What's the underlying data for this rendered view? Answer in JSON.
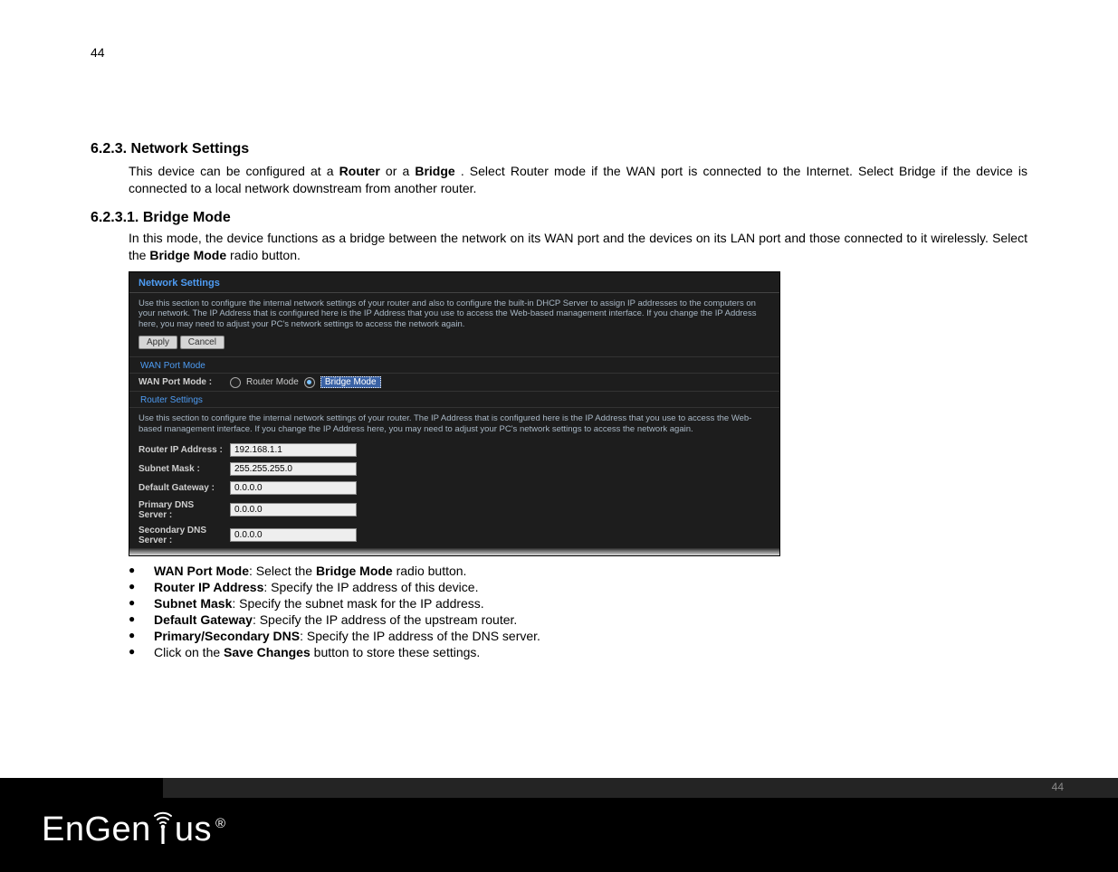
{
  "page_number_top": "44",
  "page_number_bottom": "44",
  "brand": {
    "left": "EnGen",
    "right": "us",
    "trademark": "®"
  },
  "section": {
    "num_title": "6.2.3. Network Settings",
    "intro_a": "This device can be configured at a ",
    "intro_router": "Router",
    "intro_b": " or a ",
    "intro_bridge": "Bridge",
    "intro_c": ". Select Router mode if the WAN port is connected to the Internet. Select Bridge if the device is connected to a local network downstream from another router."
  },
  "subsection": {
    "num_title": "6.2.3.1. Bridge Mode",
    "intro_a": "In this mode, the device functions as a bridge between the network on its WAN port and the devices on its LAN port and those connected to it wirelessly. Select the ",
    "bold": "Bridge Mode",
    "intro_b": " radio button."
  },
  "panel": {
    "title": "Network Settings",
    "note1": "Use this section to configure the internal network settings of your router and also to configure the built-in DHCP Server to assign IP addresses to the computers on your network. The IP Address that is configured here is the IP Address that you use to access the Web-based management interface. If you change the IP Address here, you may need to adjust your PC's network settings to access the network again.",
    "apply": "Apply",
    "cancel": "Cancel",
    "sub_wanmode": "WAN Port Mode",
    "wanlabel": "WAN Port Mode :",
    "opt_router": "Router Mode",
    "opt_bridge": "Bridge Mode",
    "sub_router": "Router Settings",
    "note2": "Use this section to configure the internal network settings of your router. The IP Address that is configured here is the IP Address that you use to access the Web-based management interface. If you change the IP Address here, you may need to adjust your PC's network settings to access the network again.",
    "rows": {
      "router_ip_l": "Router IP Address :",
      "router_ip_v": "192.168.1.1",
      "subnet_l": "Subnet Mask :",
      "subnet_v": "255.255.255.0",
      "gateway_l": "Default Gateway :",
      "gateway_v": "0.0.0.0",
      "dns1_l": "Primary DNS Server :",
      "dns1_v": "0.0.0.0",
      "dns2_l": "Secondary DNS Server :",
      "dns2_v": "0.0.0.0"
    }
  },
  "bullets": {
    "b1a": "WAN Port Mode",
    "b1b": ": Select the ",
    "b1c": "Bridge Mode",
    "b1d": " radio button.",
    "b2a": "Router IP Address",
    "b2b": ": Specify the IP address of this device.",
    "b3a": "Subnet Mask",
    "b3b": ": Specify the subnet mask for the IP address.",
    "b4a": "Default Gateway",
    "b4b": ": Specify the IP address of the upstream router.",
    "b5a": "Primary/Secondary DNS",
    "b5b": ": Specify the IP address of the DNS server.",
    "b6a": "Click on the ",
    "b6b": "Save Changes",
    "b6c": " button to store these settings."
  }
}
